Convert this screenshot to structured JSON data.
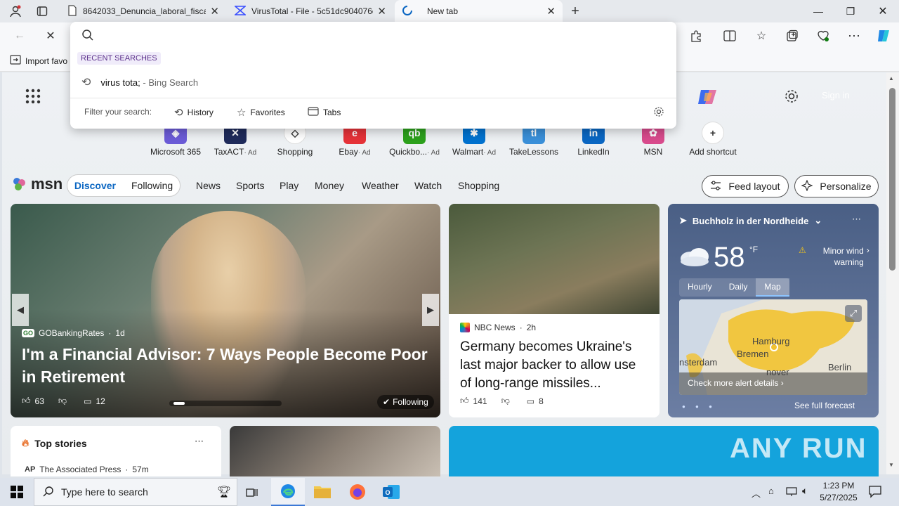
{
  "tabs": [
    {
      "label": "8642033_Denuncia_laboral_fiscal...",
      "icon": "document-icon"
    },
    {
      "label": "VirusTotal - File - 5c51dc904076c...",
      "icon": "virustotal-icon"
    },
    {
      "label": "New tab",
      "icon": "loading-icon"
    }
  ],
  "omnibox": {
    "query": "",
    "recent_header": "RECENT SEARCHES",
    "recent": [
      {
        "text": "virus tota;",
        "suffix": " - Bing Search"
      }
    ],
    "filter_label": "Filter your search:",
    "filters": [
      "History",
      "Favorites",
      "Tabs"
    ]
  },
  "favorites": {
    "import_label": "Import favo"
  },
  "newtab": {
    "sign_in": "Sign in"
  },
  "shortcuts": [
    {
      "label": "Microsoft 365",
      "ad": "",
      "color": "#6b5bd6",
      "glyph": "◈"
    },
    {
      "label": "TaxACT",
      "ad": "· Ad",
      "color": "#1e2a5a",
      "glyph": "✕"
    },
    {
      "label": "Shopping",
      "ad": "",
      "color": "#ffffff",
      "glyph": "◇"
    },
    {
      "label": "Ebay",
      "ad": "· Ad",
      "color": "#e53238",
      "glyph": "e"
    },
    {
      "label": "Quickbo...",
      "ad": "· Ad",
      "color": "#2ca01c",
      "glyph": "qb"
    },
    {
      "label": "Walmart",
      "ad": "· Ad",
      "color": "#0071ce",
      "glyph": "✱"
    },
    {
      "label": "TakeLessons",
      "ad": "",
      "color": "#3a8fd8",
      "glyph": "tl"
    },
    {
      "label": "LinkedIn",
      "ad": "",
      "color": "#0a66c2",
      "glyph": "in"
    },
    {
      "label": "MSN",
      "ad": "",
      "color": "#d84b8c",
      "glyph": "✿"
    },
    {
      "label": "Add shortcut",
      "ad": "",
      "color": "#ffffff",
      "glyph": "+"
    }
  ],
  "msn": {
    "brand": "msn",
    "tabs": [
      "Discover",
      "Following"
    ],
    "nav": [
      "News",
      "Sports",
      "Play",
      "Money",
      "Weather",
      "Watch",
      "Shopping"
    ],
    "feed_layout": "Feed layout",
    "personalize": "Personalize"
  },
  "hero": {
    "source": "GOBankingRates",
    "age": "1d",
    "title": "I'm a Financial Advisor: 7 Ways People Become Poor in Retirement",
    "likes": "63",
    "comments": "12",
    "following": "Following"
  },
  "news": {
    "source": "NBC News",
    "age": "2h",
    "title": "Germany becomes Ukraine's last major backer to allow use of long-range missiles...",
    "likes": "141",
    "comments": "8"
  },
  "weather": {
    "location": "Buchholz in der Nordheide",
    "temp": "58",
    "unit": "°F",
    "alert": "Minor wind warning",
    "tabs": [
      "Hourly",
      "Daily",
      "Map"
    ],
    "active_tab": "Map",
    "cities": [
      "Hamburg",
      "Bremen",
      "Berlin",
      "nsterdam",
      "nover"
    ],
    "alert_link": "Check more alert details",
    "forecast": "See full forecast"
  },
  "topstories": {
    "title": "Top stories",
    "source": "The Associated Press",
    "age": "57m"
  },
  "watermark": "ANY RUN",
  "taskbar": {
    "search_placeholder": "Type here to search",
    "time": "1:23 PM",
    "date": "5/27/2025"
  }
}
